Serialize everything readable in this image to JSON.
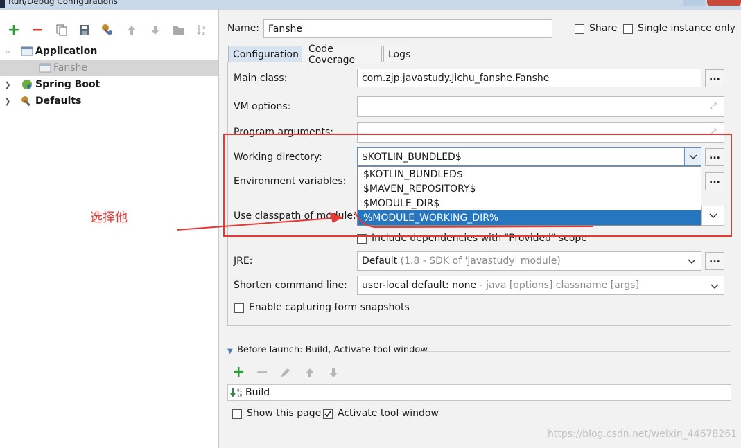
{
  "window": {
    "title": "Run/Debug Configurations"
  },
  "toolbar": {
    "add": "+",
    "remove": "−"
  },
  "tree": {
    "items": [
      {
        "label": "Application"
      },
      {
        "label": "Fanshe"
      },
      {
        "label": "Spring Boot"
      },
      {
        "label": "Defaults"
      }
    ]
  },
  "header": {
    "name_label": "Name:",
    "name_value": "Fanshe",
    "share_label": "Share",
    "single_label": "Single instance only"
  },
  "tabs": [
    {
      "label": "Configuration"
    },
    {
      "label": "Code Coverage"
    },
    {
      "label": "Logs"
    }
  ],
  "form": {
    "main_class_label": "Main class:",
    "main_class_value": "com.zjp.javastudy.jichu_fanshe.Fanshe",
    "vm_label": "VM options:",
    "program_args_label": "Program arguments:",
    "working_dir_label": "Working directory:",
    "working_dir_value": "$KOTLIN_BUNDLED$",
    "env_label": "Environment variables:",
    "classpath_label": "Use classpath of module:",
    "include_deps_label": "Include dependencies with \"Provided\" scope",
    "jre_label": "JRE:",
    "jre_value": "Default",
    "jre_hint": "(1.8 - SDK of 'javastudy' module)",
    "shorten_label": "Shorten command line:",
    "shorten_value": "user-local default: none",
    "shorten_hint": "- java [options] classname [args]",
    "capture_label": "Enable capturing form snapshots",
    "browse": "..."
  },
  "dropdown": {
    "options": [
      "$KOTLIN_BUNDLED$",
      "$MAVEN_REPOSITORY$",
      "$MODULE_DIR$",
      "%MODULE_WORKING_DIR%"
    ],
    "selected_index": 3
  },
  "before_launch": {
    "title": "Before launch: Build, Activate tool window",
    "task": "Build",
    "show_page_label": "Show this page",
    "activate_label": "Activate tool window"
  },
  "annotation": {
    "text": "选择他",
    "color": "#e53935"
  },
  "watermark": "https://blog.csdn.net/weixin_44678261"
}
